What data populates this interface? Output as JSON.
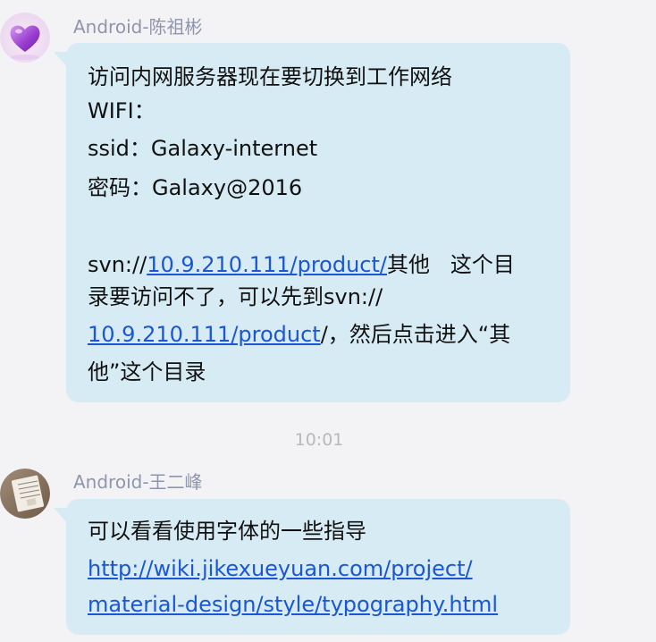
{
  "messages": [
    {
      "sender": "Android-陈祖彬",
      "avatar_icon": "purple-heart-avatar-icon",
      "lines": {
        "l1": "访问内网服务器现在要切换到工作网络",
        "l2": "WIFI：",
        "l3": "ssid：Galaxy-internet",
        "l4": "密码：Galaxy@2016",
        "l5_prefix": "svn://",
        "l5_link": "10.9.210.111/product/",
        "l5_suffix": "其他   这个目",
        "l6": "录要访问不了，可以先到svn://",
        "l7_link": "10.9.210.111/product",
        "l7_suffix": "/，然后点击进入“其",
        "l8": "他”这个目录"
      }
    },
    {
      "sender": "Android-王二峰",
      "avatar_icon": "notebook-photo-avatar-icon",
      "lines": {
        "l1": "可以看看使用字体的一些指导",
        "link_line1": "http://wiki.jikexueyuan.com/project/",
        "link_line2": "material-design/style/typography.html"
      }
    }
  ],
  "timestamp": "10:01",
  "colors": {
    "background": "#f3f3f6",
    "bubble": "#d7ebf4",
    "sender_name": "#8e95ad",
    "link": "#1a56d6",
    "timestamp": "#b8b8bc"
  }
}
